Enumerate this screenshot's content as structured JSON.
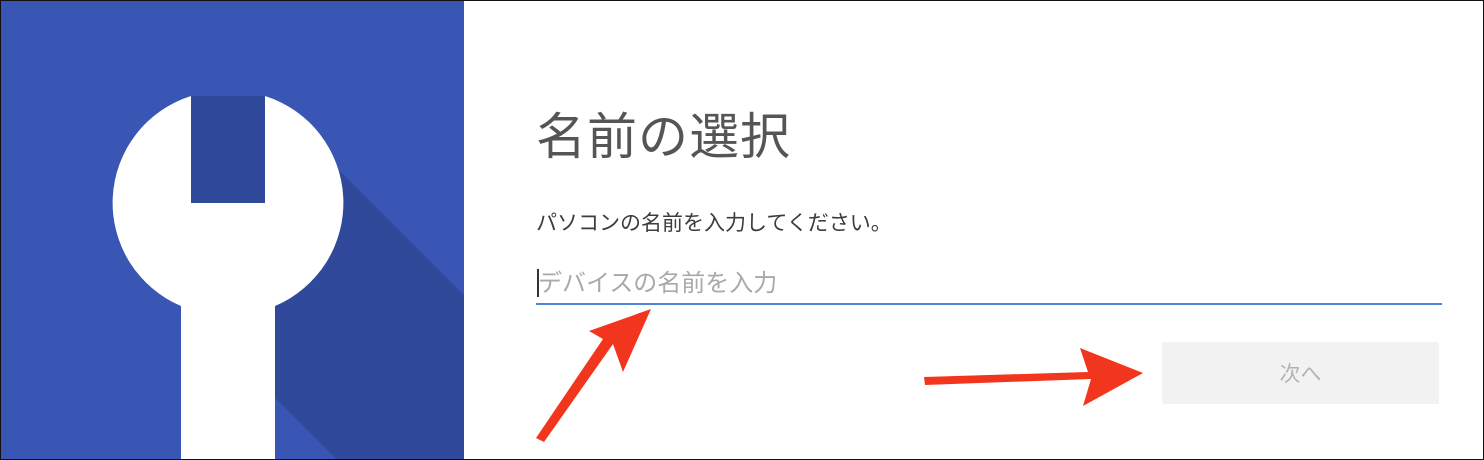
{
  "setup": {
    "title": "名前の選択",
    "prompt": "パソコンの名前を入力してください。",
    "name_input": {
      "value": "",
      "placeholder": "デバイスの名前を入力"
    },
    "next_label": "次へ"
  },
  "colors": {
    "hero_background": "#3a56b5",
    "hero_shadow": "#30499b",
    "wrench": "#ffffff",
    "input_underline": "#4c86d9",
    "next_button_bg": "#f2f2f2",
    "next_button_text": "#b3b3b3",
    "annotation_arrow": "#f2361d"
  },
  "icons": {
    "hero": "wrench-icon",
    "annotations": [
      "red-arrow-icon",
      "red-arrow-icon"
    ]
  }
}
